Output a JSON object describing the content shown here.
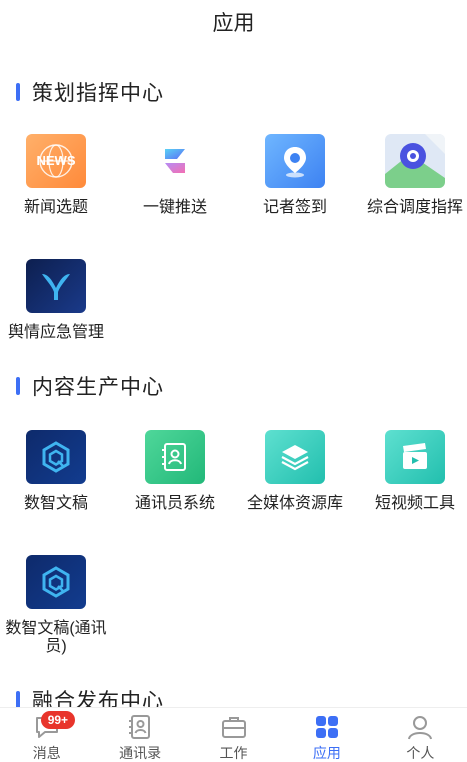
{
  "header": {
    "title": "应用"
  },
  "sections": [
    {
      "title": "策划指挥中心",
      "apps": [
        {
          "label": "新闻选题",
          "icon": "news-icon",
          "icon_text": "NEWS"
        },
        {
          "label": "一键推送",
          "icon": "push-icon"
        },
        {
          "label": "记者签到",
          "icon": "location-checkin-icon"
        },
        {
          "label": "综合调度指挥",
          "icon": "map-dispatch-icon"
        },
        {
          "label": "舆情应急管理",
          "icon": "public-opinion-icon"
        }
      ]
    },
    {
      "title": "内容生产中心",
      "apps": [
        {
          "label": "数智文稿",
          "icon": "smart-manuscript-icon"
        },
        {
          "label": "通讯员系统",
          "icon": "contacts-book-icon"
        },
        {
          "label": "全媒体资源库",
          "icon": "layers-icon"
        },
        {
          "label": "短视频工具",
          "icon": "clapperboard-icon"
        },
        {
          "label": "数智文稿(通讯员)",
          "icon": "smart-manuscript-icon"
        }
      ]
    },
    {
      "title": "融合发布中心"
    }
  ],
  "tabbar": {
    "items": [
      {
        "label": "消息",
        "icon": "message-icon",
        "badge": "99+"
      },
      {
        "label": "通讯录",
        "icon": "address-book-icon"
      },
      {
        "label": "工作",
        "icon": "briefcase-icon"
      },
      {
        "label": "应用",
        "icon": "apps-grid-icon",
        "active": true
      },
      {
        "label": "个人",
        "icon": "person-icon"
      }
    ]
  },
  "colors": {
    "accent": "#3d6ff5",
    "badge": "#e8342b"
  }
}
